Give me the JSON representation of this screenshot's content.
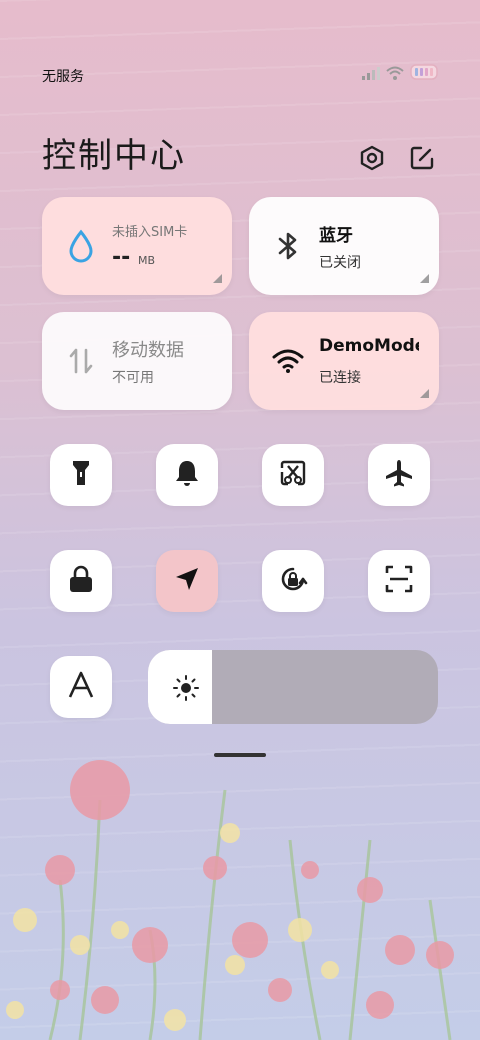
{
  "status": {
    "carrier": "无服务"
  },
  "header": {
    "title": "控制中心"
  },
  "tiles": {
    "data": {
      "label": "未插入SIM卡",
      "value": "--",
      "unit": "MB"
    },
    "bluetooth": {
      "label": "蓝牙",
      "status": "已关闭"
    },
    "mobile_data": {
      "label": "移动数据",
      "status": "不可用"
    },
    "wifi": {
      "label": "DemoMode",
      "status": "已连接"
    }
  },
  "quick_toggles": [
    {
      "icon": "flashlight-icon",
      "active": false
    },
    {
      "icon": "bell-icon",
      "active": false
    },
    {
      "icon": "screenshot-icon",
      "active": false
    },
    {
      "icon": "airplane-icon",
      "active": false
    },
    {
      "icon": "lock-icon",
      "active": false
    },
    {
      "icon": "location-icon",
      "active": true
    },
    {
      "icon": "rotation-lock-icon",
      "active": false
    },
    {
      "icon": "scan-icon",
      "active": false
    },
    {
      "icon": "font-size-icon",
      "active": false
    }
  ],
  "brightness": {
    "level": 0.22
  },
  "colors": {
    "accent_active": "#f3c5c9",
    "data_drop": "#3aa3e3",
    "slider_track": "#b1acb7"
  }
}
